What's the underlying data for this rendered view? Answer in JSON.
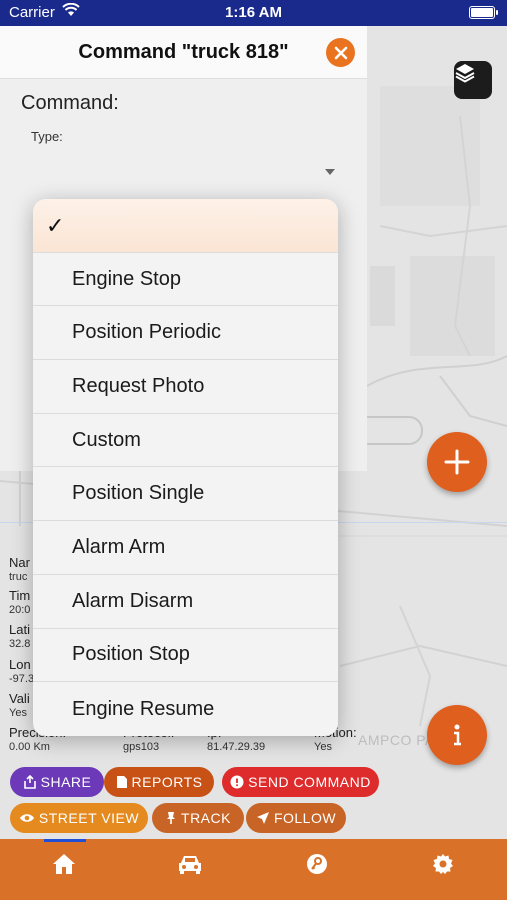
{
  "status_bar": {
    "carrier": "Carrier",
    "time": "1:16 AM"
  },
  "command_sheet": {
    "title": "Command \"truck 818\"",
    "section_label": "Command:",
    "type_label": "Type:"
  },
  "dropdown": {
    "selected_mark": "✓",
    "items": [
      "Engine Stop",
      "Position Periodic",
      "Request Photo",
      "Custom",
      "Position Single",
      "Alarm Arm",
      "Alarm Disarm",
      "Position Stop",
      "Engine Resume"
    ]
  },
  "info_panel": {
    "col1": [
      {
        "label": "Nar",
        "value": "truc"
      },
      {
        "label": "Tim",
        "value": "20:0"
      },
      {
        "label": "Lati",
        "value": "32.8"
      },
      {
        "label": "Lon",
        "value": "-97.3"
      },
      {
        "label": "Vali",
        "value": "Yes"
      },
      {
        "label": "Precision:",
        "value": "0.00 Km"
      }
    ],
    "protocol": {
      "label": "Protocol:",
      "value": "gps103"
    },
    "ip": {
      "label": "Ip:",
      "value": "81.47.29.39"
    },
    "motion": {
      "label": "Motion:",
      "value": "Yes"
    }
  },
  "map": {
    "label": "AMPCO PAINT"
  },
  "actions": {
    "share": "SHARE",
    "reports": "REPORTS",
    "send_command": "SEND COMMAND",
    "street_view": "STREET VIEW",
    "track": "TRACK",
    "follow": "FOLLOW"
  },
  "colors": {
    "status_bar": "#1a2a8c",
    "accent": "#df5f1e",
    "tab_bar": "#d97228",
    "share": "#6c3ab8",
    "send_command": "#de2b2b",
    "street_view": "#e48a1f"
  },
  "icons": {
    "tabs": [
      "home-icon",
      "car-icon",
      "key-icon",
      "gear-icon"
    ],
    "layers": "layers-icon",
    "close": "close-icon",
    "add": "plus-icon",
    "info": "info-icon"
  }
}
